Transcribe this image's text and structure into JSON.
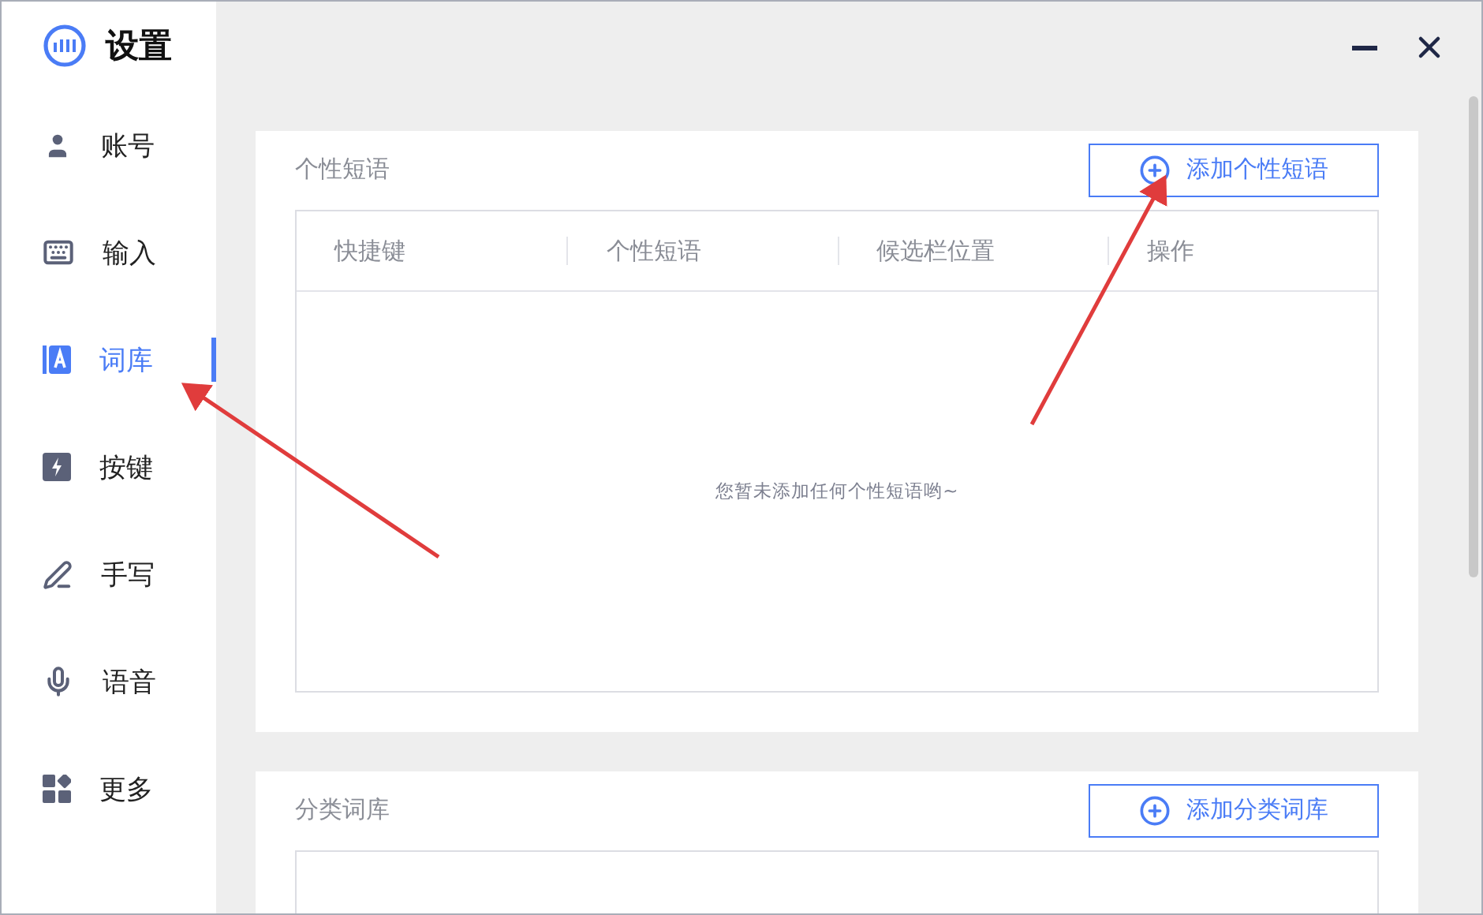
{
  "app": {
    "title": "设置"
  },
  "sidebar": {
    "items": [
      {
        "label": "账号",
        "selected": false
      },
      {
        "label": "输入",
        "selected": false
      },
      {
        "label": "词库",
        "selected": true
      },
      {
        "label": "按键",
        "selected": false
      },
      {
        "label": "手写",
        "selected": false
      },
      {
        "label": "语音",
        "selected": false
      },
      {
        "label": "更多",
        "selected": false
      }
    ]
  },
  "sections": [
    {
      "title": "个性短语",
      "button": "添加个性短语",
      "table": {
        "columns": [
          "快捷键",
          "个性短语",
          "候选栏位置",
          "操作"
        ],
        "empty_text": "您暂未添加任何个性短语哟~"
      }
    },
    {
      "title": "分类词库",
      "button": "添加分类词库"
    }
  ]
}
